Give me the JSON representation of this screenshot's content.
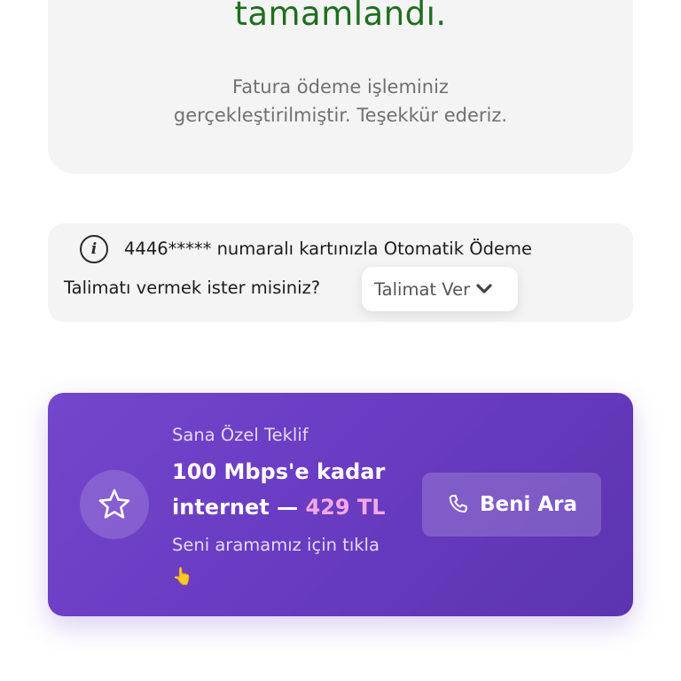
{
  "success": {
    "title": "tamamlandı.",
    "message_line1": "Fatura ödeme işleminiz",
    "message_line2": "gerçekleştirilmiştir. Teşekkür ederiz."
  },
  "autopay": {
    "info_icon": "info-icon",
    "line1": "4446***** numaralı kartınızla Otomatik Ödeme",
    "line2": "Talimatı vermek ister misiniz?",
    "select_label": "Talimat Ver"
  },
  "offer": {
    "label": "Sana Özel Teklif",
    "title_part1": "100 Mbps'e kadar internet — ",
    "title_price": "429 TL",
    "subtitle": "Seni aramamız için tıkla",
    "subtitle_emoji": "👆",
    "call_button_label": "Beni Ara",
    "colors": {
      "accent": "#6a3cc3",
      "price": "#f3a8e6",
      "success_green": "#1e6e1e"
    }
  }
}
